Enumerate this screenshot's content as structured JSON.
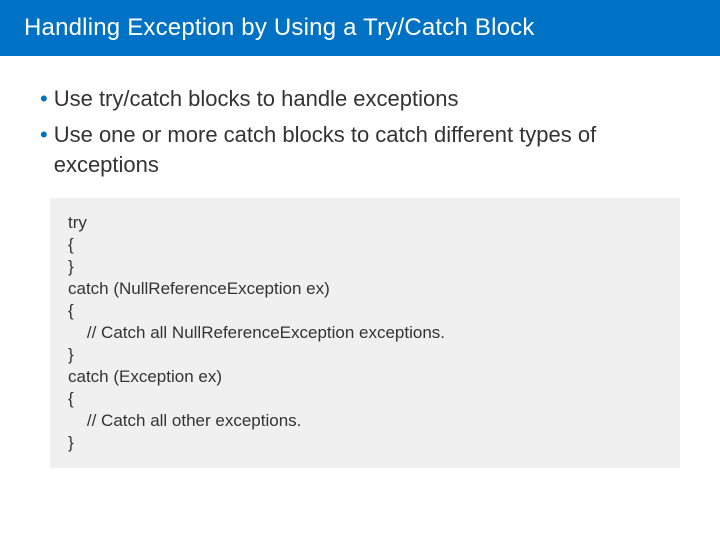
{
  "title": "Handling Exception by Using a Try/Catch Block",
  "bullets": [
    "Use try/catch blocks to handle exceptions",
    "Use one or more catch blocks to catch different types of exceptions"
  ],
  "code": "try\n{\n}\ncatch (NullReferenceException ex)\n{\n    // Catch all NullReferenceException exceptions.\n}\ncatch (Exception ex)\n{\n    // Catch all other exceptions.\n}"
}
